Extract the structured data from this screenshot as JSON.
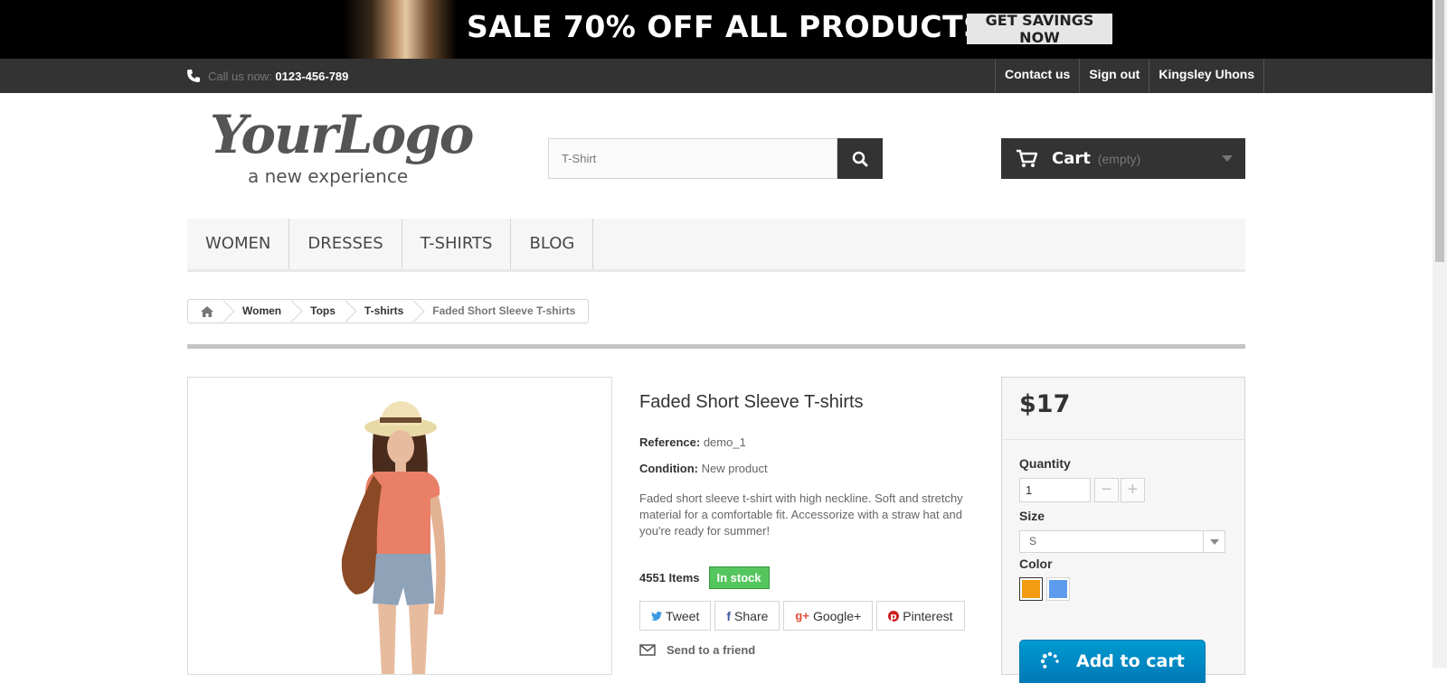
{
  "banner": {
    "headline": "SALE 70% OFF ALL PRODUCTS",
    "cta": "GET SAVINGS NOW"
  },
  "topnav": {
    "call_label": "Call us now: ",
    "phone": "0123-456-789",
    "links": [
      "Contact us",
      "Sign out",
      "Kingsley Uhons"
    ]
  },
  "logo": {
    "main": "YourLogo",
    "tagline": "a new experience"
  },
  "search": {
    "value": "T-Shirt"
  },
  "cart": {
    "label": "Cart",
    "status": "(empty)"
  },
  "menu": [
    "WOMEN",
    "DRESSES",
    "T-SHIRTS",
    "BLOG"
  ],
  "breadcrumb": [
    "Women",
    "Tops",
    "T-shirts",
    "Faded Short Sleeve T-shirts"
  ],
  "product": {
    "title": "Faded Short Sleeve T-shirts",
    "reference_label": "Reference:",
    "reference": "demo_1",
    "condition_label": "Condition:",
    "condition": "New product",
    "description": "Faded short sleeve t-shirt with high neckline. Soft and stretchy material for a comfortable fit. Accessorize with a straw hat and you're ready for summer!",
    "quantity_in_stock": "4551 Items",
    "stock_status": "In stock",
    "share": [
      "Tweet",
      "Share",
      "Google+",
      "Pinterest"
    ],
    "send_to_friend": "Send to a friend"
  },
  "buy": {
    "price": "$17",
    "quantity_label": "Quantity",
    "quantity": "1",
    "size_label": "Size",
    "size": "S",
    "color_label": "Color",
    "colors": [
      "#f39c11",
      "#5d9cec"
    ],
    "add_to_cart": "Add to cart"
  }
}
